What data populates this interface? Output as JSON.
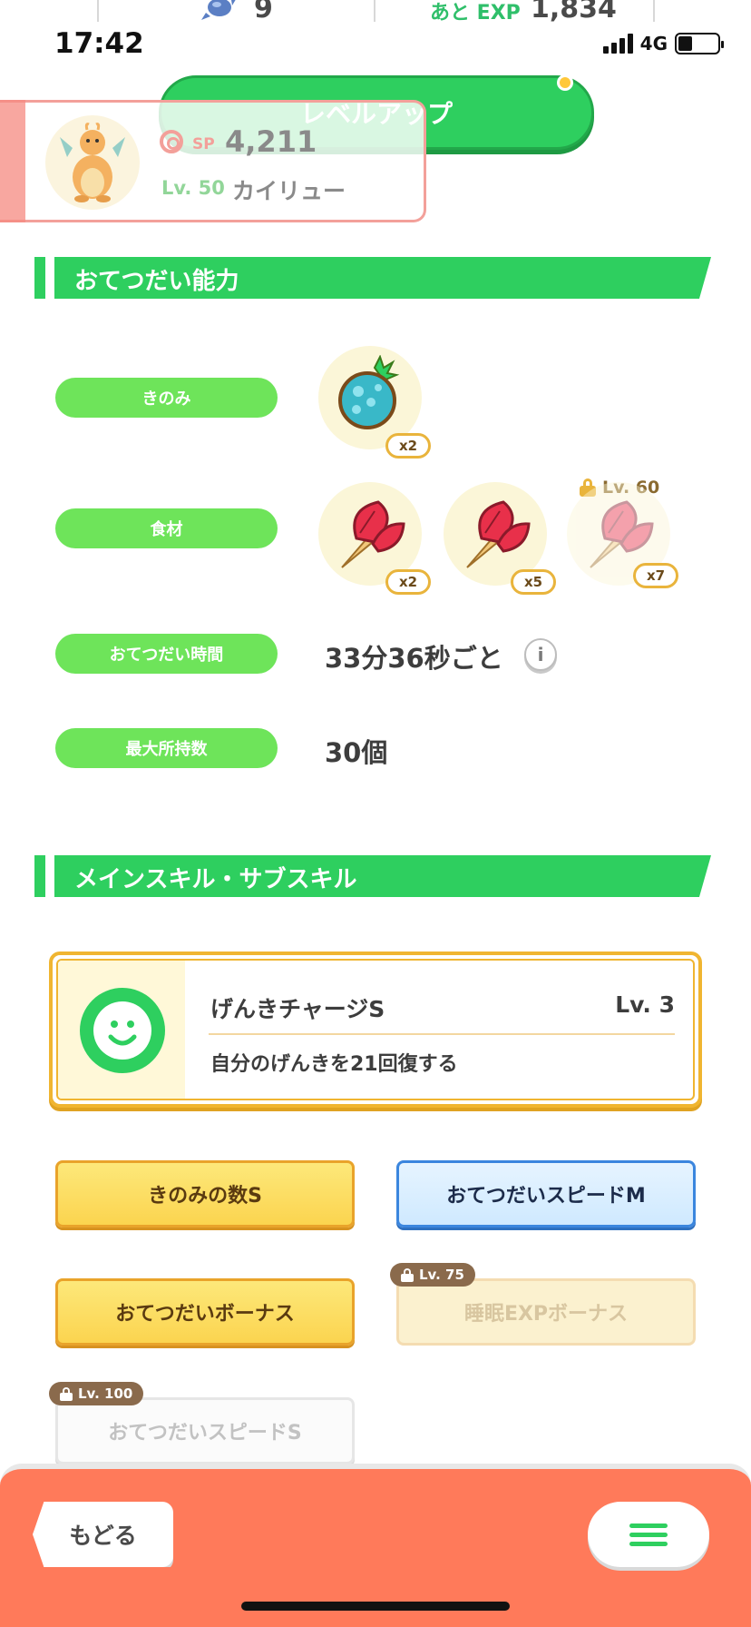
{
  "header": {
    "candy_count": "9",
    "exp_label": "あと EXP",
    "exp_value": "1,834",
    "level_up_label": "レベルアップ"
  },
  "status_bar": {
    "time": "17:42",
    "network": "4G",
    "battery_level": 0.36
  },
  "pokemon": {
    "sp_label": "SP",
    "sp_value": "4,211",
    "level": "Lv. 50",
    "name": "カイリュー"
  },
  "helper_section": {
    "title": "おてつだい能力",
    "berry_label": "きのみ",
    "berry": {
      "icon": "rawst-berry-icon",
      "count": "x2"
    },
    "ingredients_label": "食材",
    "ingredients": [
      {
        "icon": "fiery-herb-icon",
        "count": "x2",
        "locked": false
      },
      {
        "icon": "fiery-herb-icon",
        "count": "x5",
        "locked": false
      },
      {
        "icon": "fiery-herb-icon",
        "count": "x7",
        "locked": true,
        "unlock_level": "Lv. 60"
      }
    ],
    "help_time_label": "おてつだい時間",
    "help_time_value": "33分36秒ごと",
    "info_icon": "i",
    "max_carry_label": "最大所持数",
    "max_carry_value": "30個"
  },
  "skill_section": {
    "title": "メインスキル・サブスキル",
    "main_skill": {
      "icon": "smile-icon",
      "name": "げんきチャージS",
      "level": "Lv. 3",
      "description": "自分のげんきを21回復する"
    },
    "sub_skills": [
      {
        "label": "きのみの数S",
        "style": "gold",
        "locked": false
      },
      {
        "label": "おてつだいスピードM",
        "style": "blue",
        "locked": false
      },
      {
        "label": "おてつだいボーナス",
        "style": "gold",
        "locked": false
      },
      {
        "label": "睡眠EXPボーナス",
        "style": "gold",
        "locked": true,
        "unlock_level": "Lv. 75"
      },
      {
        "label": "おてつだいスピードS",
        "style": "white",
        "locked": true,
        "unlock_level": "Lv. 100"
      }
    ]
  },
  "bottom_bar": {
    "back_label": "もどる",
    "menu_icon": "hamburger-menu-icon"
  },
  "colors": {
    "accent_green": "#2ecf5f",
    "pill_green": "#6ee45a",
    "gold": "#f0b531",
    "blue": "#3b86de",
    "bottom_bar": "#ff7a5a"
  }
}
